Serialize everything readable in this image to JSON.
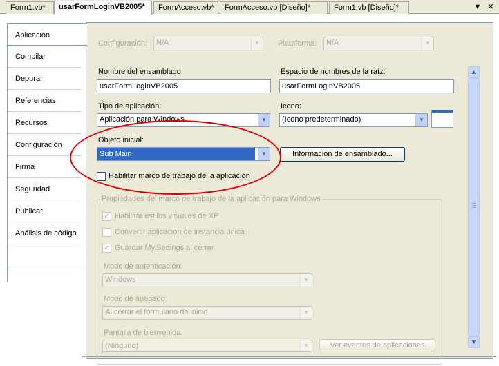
{
  "document_tabs": [
    {
      "label": "Form1.vb*",
      "active": false
    },
    {
      "label": "usarFormLoginVB2005*",
      "active": true
    },
    {
      "label": "FormAcceso.vb*",
      "active": false
    },
    {
      "label": "FormAcceso.vb [Diseño]*",
      "active": false
    },
    {
      "label": "Form1.vb [Diseño]*",
      "active": false
    }
  ],
  "strip_buttons": {
    "dropdown_icon": "▼",
    "close_icon": "✕"
  },
  "property_tabs": [
    {
      "label": "Aplicación",
      "active": true
    },
    {
      "label": "Compilar"
    },
    {
      "label": "Depurar"
    },
    {
      "label": "Referencias"
    },
    {
      "label": "Recursos"
    },
    {
      "label": "Configuración"
    },
    {
      "label": "Firma"
    },
    {
      "label": "Seguridad"
    },
    {
      "label": "Publicar"
    },
    {
      "label": "Análisis de código"
    }
  ],
  "config": {
    "configuracion_label": "Configuración:",
    "configuracion_value": "N/A",
    "plataforma_label": "Plataforma:",
    "plataforma_value": "N/A"
  },
  "app": {
    "assembly_name_label": "Nombre del ensamblado:",
    "assembly_name_value": "usarFormLoginVB2005",
    "root_namespace_label": "Espacio de nombres de la raíz:",
    "root_namespace_value": "usarFormLoginVB2005",
    "app_type_label": "Tipo de aplicación:",
    "app_type_value": "Aplicación para Windows",
    "icon_label": "Icono:",
    "icon_value": "(Icono predeterminado)",
    "startup_object_label": "Objeto inicial:",
    "startup_object_value": "Sub Main",
    "assembly_info_button": "Información de ensamblado...",
    "enable_framework_label": "Habilitar marco de trabajo de la aplicación",
    "enable_framework_checked": false
  },
  "framework": {
    "group_title": "Propiedades del marco de trabajo de la aplicación para Windows",
    "xp_styles_label": "Habilitar estilos visuales de XP",
    "xp_styles_checked": true,
    "single_instance_label": "Convertir aplicación de instancia única",
    "single_instance_checked": false,
    "save_settings_label": "Guardar My.Settings al cerrar",
    "save_settings_checked": true,
    "auth_mode_label": "Modo de autenticación:",
    "auth_mode_value": "Windows",
    "shutdown_mode_label": "Modo de apagado:",
    "shutdown_mode_value": "Al cerrar el formulario de inicio",
    "splash_label": "Pantalla de bienvenida:",
    "splash_value": "(Ninguno)",
    "app_events_button": "Ver eventos de aplicaciones"
  },
  "colors": {
    "highlight_ellipse": "#e00000",
    "selection": "#316ac5"
  }
}
